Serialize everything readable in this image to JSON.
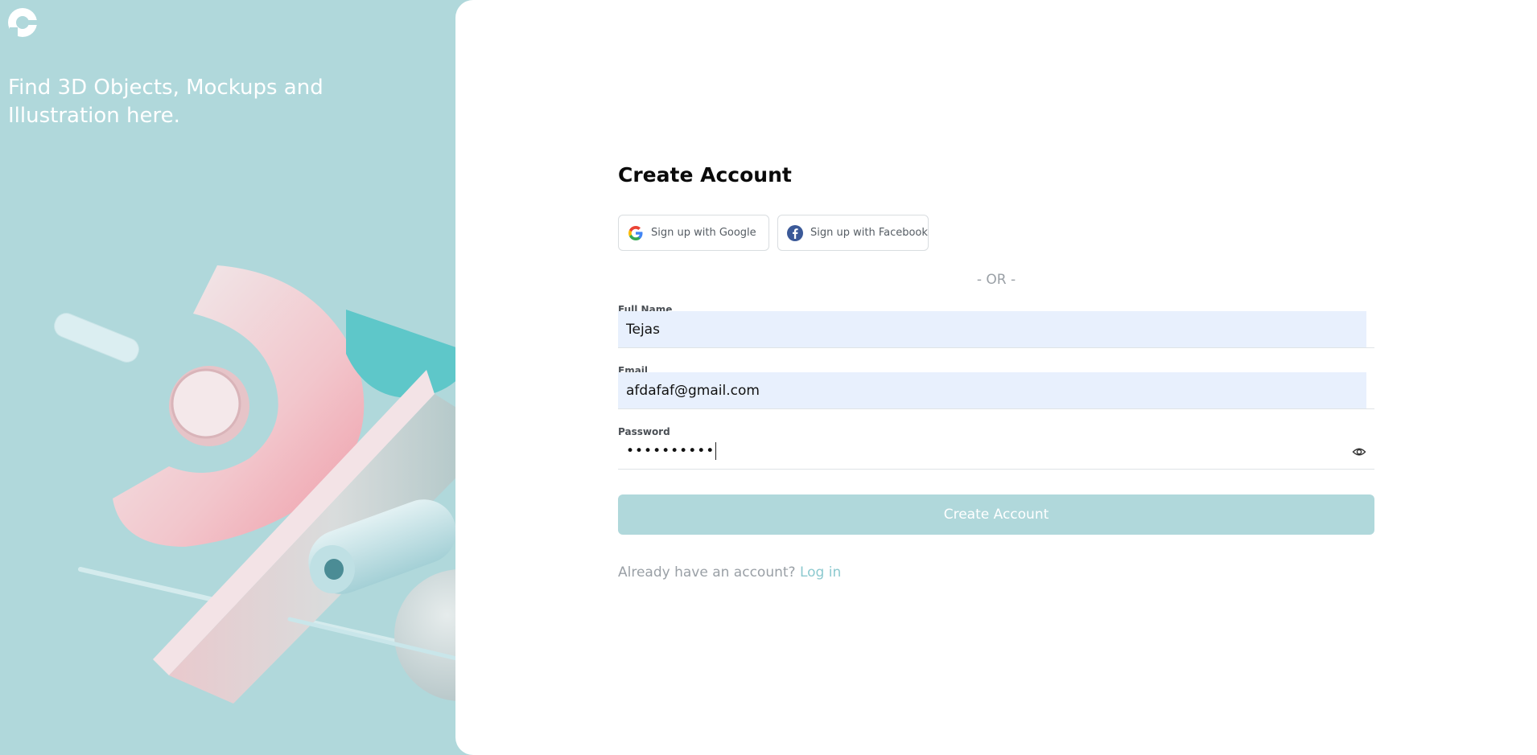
{
  "brand": {
    "logo_icon": "brand-logo-icon",
    "tagline": "Find 3D Objects, Mockups and Illustration here."
  },
  "colors": {
    "accent": "#b0d8db",
    "link": "#8cc9cf",
    "autofill": "#e8f0fd"
  },
  "form": {
    "title": "Create Account",
    "social": {
      "google_label": "Sign up with Google",
      "facebook_label": "Sign up with Facebook"
    },
    "separator": "- OR -",
    "full_name": {
      "label": "Full Name",
      "value": "Tejas"
    },
    "email": {
      "label": "Email",
      "value": "afdafaf@gmail.com"
    },
    "password": {
      "label": "Password",
      "value": "••••••••••",
      "toggle_icon": "eye-icon"
    },
    "submit_label": "Create Account",
    "footer": {
      "prompt": "Already have an account?",
      "link": "Log in"
    }
  }
}
